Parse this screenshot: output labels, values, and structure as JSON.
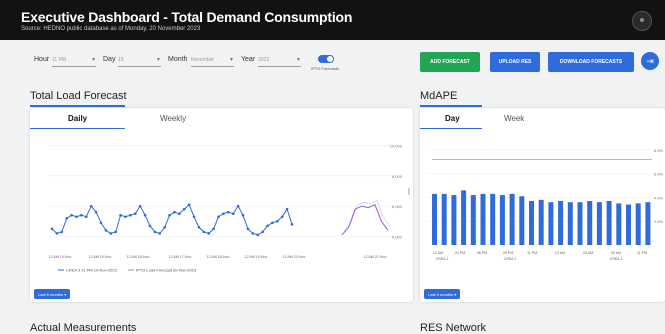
{
  "header": {
    "title": "Executive Dashboard - Total Demand Consumption",
    "source": "Source: HEDNO public database as of  Monday, 20 November 2023"
  },
  "filters": {
    "hour": {
      "label": "Hour",
      "value": "11 PM"
    },
    "day": {
      "label": "Day",
      "value": "19"
    },
    "month": {
      "label": "Month",
      "value": "November"
    },
    "year": {
      "label": "Year",
      "value": "2023"
    },
    "ipto_toggle": {
      "label": "IPTO Forecasts",
      "on": true
    }
  },
  "actions": {
    "add_forecast": "ADD FORECAST",
    "upload_res": "UPLOAD RES",
    "download_forecasts": "DOWNLOAD FORECASTS"
  },
  "load_forecast": {
    "title": "Total Load Forecast",
    "tabs": [
      "Daily",
      "Weekly"
    ],
    "range_button": "Last 6 months"
  },
  "mdape": {
    "title": "MdAPE",
    "tabs": [
      "Day",
      "Week"
    ],
    "range_button": "Last 3 months"
  },
  "bottom": {
    "left_title": "Actual Measurements",
    "right_title": "RES Network"
  },
  "colors": {
    "accent": "#2f6bd9",
    "green": "#23a455",
    "header_bg": "#121212",
    "series_main": "#2f6bd9",
    "series_forecast": "#9c5bc9"
  },
  "chart_data": [
    {
      "type": "line",
      "title": "",
      "yticks": [
        "10,000",
        "8,000",
        "6,000",
        "4,000"
      ],
      "ylim": [
        3500,
        10500
      ],
      "xticks": [
        "12 AM 14-Nov",
        "12 AM 15-Nov",
        "12 AM 16-Nov",
        "12 AM 17-Nov",
        "12 AM 18-Nov",
        "12 AM 19-Nov",
        "12 AM 20-Nov",
        "12 AM 21-Nov"
      ],
      "grid": true,
      "legend_position": "bottom",
      "series": [
        {
          "name": "CREA 3 11 PM 19-Nov-2023",
          "values": [
            4500,
            4200,
            4300,
            5200,
            5400,
            5300,
            5400,
            5300,
            6000,
            5600,
            4900,
            4400,
            4200,
            4300,
            5400,
            5300,
            5400,
            5500,
            6000,
            5400,
            4700,
            4300,
            4200,
            4600,
            5400,
            5600,
            5500,
            5800,
            6100,
            5300,
            4600,
            4300,
            4200,
            4500,
            5300,
            5500,
            5600,
            5500,
            6000,
            5400,
            4500,
            4200,
            4100,
            4300,
            4700,
            4900,
            5000,
            5300,
            5800,
            4800
          ]
        },
        {
          "name": "IPTO Load Forecast 20-Nov-2023",
          "values": [
            4100,
            4600,
            5800,
            6000,
            5900,
            6100,
            5000,
            4400
          ]
        }
      ]
    },
    {
      "type": "bar",
      "title": "",
      "yticks": [
        "8.0%",
        "6.0%",
        "4.0%",
        "2.0%"
      ],
      "ylim": [
        0,
        9
      ],
      "xticks": [
        "12 AM",
        "03 PM",
        "06 PM",
        "09 PM",
        "11 PM",
        "12 AM",
        "03 AM",
        "09 AM",
        "11 PM"
      ],
      "group_labels": [
        "CREA 1",
        "CREA 2",
        "CREA 3"
      ],
      "grid": true,
      "series": [
        {
          "name": "MdAPE",
          "values": [
            4.3,
            4.3,
            4.2,
            4.6,
            4.2,
            4.3,
            4.3,
            4.2,
            4.3,
            4.1,
            3.7,
            3.8,
            3.6,
            3.7,
            3.6,
            3.6,
            3.7,
            3.6,
            3.7,
            3.5,
            3.4,
            3.5,
            3.6
          ]
        }
      ],
      "target_line": 7.2
    }
  ]
}
